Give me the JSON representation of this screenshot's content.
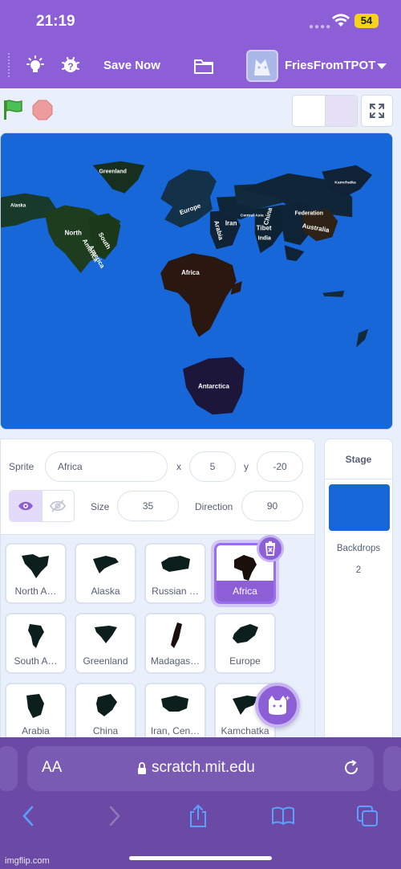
{
  "status_bar": {
    "time": "21:19",
    "battery": "54"
  },
  "menu": {
    "save_label": "Save Now",
    "username": "FriesFromTPOT",
    "icons": [
      "lightbulb-icon",
      "debug-icon",
      "folder-icon"
    ]
  },
  "stage": {
    "labels": [
      {
        "text": "Greenland"
      },
      {
        "text": "Alaska"
      },
      {
        "text": "North"
      },
      {
        "text": "America"
      },
      {
        "text": "South"
      },
      {
        "text": "America"
      },
      {
        "text": "Europe"
      },
      {
        "text": "Iran"
      },
      {
        "text": "Arabia"
      },
      {
        "text": "Central Asia"
      },
      {
        "text": "Tibet"
      },
      {
        "text": "India"
      },
      {
        "text": "China"
      },
      {
        "text": "Federation"
      },
      {
        "text": "Kamchatka"
      },
      {
        "text": "Australia"
      },
      {
        "text": "Africa"
      },
      {
        "text": "Antarctica"
      }
    ]
  },
  "sprite_info": {
    "sprite_label": "Sprite",
    "sprite_name": "Africa",
    "x_label": "x",
    "x_value": "5",
    "y_label": "y",
    "y_value": "-20",
    "size_label": "Size",
    "size_value": "35",
    "direction_label": "Direction",
    "direction_value": "90"
  },
  "sprites": [
    {
      "name": "North A…",
      "selected": false
    },
    {
      "name": "Alaska",
      "selected": false
    },
    {
      "name": "Russian …",
      "selected": false
    },
    {
      "name": "Africa",
      "selected": true
    },
    {
      "name": "South A…",
      "selected": false
    },
    {
      "name": "Greenland",
      "selected": false
    },
    {
      "name": "Madagas…",
      "selected": false
    },
    {
      "name": "Europe",
      "selected": false
    },
    {
      "name": "Arabia",
      "selected": false
    },
    {
      "name": "China",
      "selected": false
    },
    {
      "name": "Iran, Cen…",
      "selected": false
    },
    {
      "name": "Kamchatka",
      "selected": false
    }
  ],
  "stage_panel": {
    "title": "Stage",
    "backdrops_label": "Backdrops",
    "backdrops_count": "2"
  },
  "browser": {
    "aa": "AA",
    "url": "scratch.mit.edu"
  },
  "watermark": "imgflip.com"
}
